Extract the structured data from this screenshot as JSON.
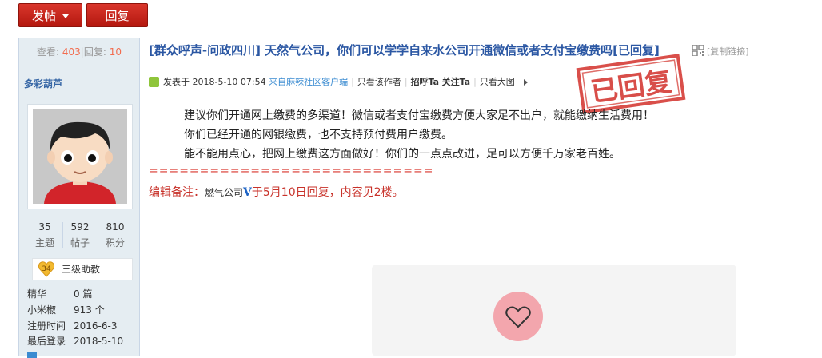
{
  "toolbar": {
    "post_label": "发帖",
    "reply_label": "回复"
  },
  "stats": {
    "views_label": "查看:",
    "views": "403",
    "replies_label": "回复:",
    "replies": "10"
  },
  "author": {
    "name": "多彩葫芦",
    "counts": [
      {
        "value": "35",
        "label": "主题"
      },
      {
        "value": "592",
        "label": "帖子"
      },
      {
        "value": "810",
        "label": "积分"
      }
    ],
    "rank_level": "34",
    "rank_name": "三级助教",
    "info": [
      {
        "key": "精华",
        "value": "0 篇"
      },
      {
        "key": "小米椒",
        "value": "913 个"
      },
      {
        "key": "注册时间",
        "value": "2016-6-3"
      },
      {
        "key": "最后登录",
        "value": "2018-5-10"
      }
    ]
  },
  "thread": {
    "title": "[群众呼声-问政四川] 天然气公司，你们可以学学自来水公司开通微信或者支付宝缴费吗[已回复]",
    "copy_link": "[复制链接]"
  },
  "meta": {
    "posted_prefix": "发表于 2018-5-10 07:54",
    "source": "来自麻辣社区客户端",
    "only_author": "只看该作者",
    "greet": "招呼Ta",
    "follow": "关注Ta",
    "only_large": "只看大图"
  },
  "stamp": {
    "text": "已回复"
  },
  "post": {
    "lines": [
      "建议你们开通网上缴费的多渠道！微信或者支付宝缴费方便大家足不出户，就能缴纳生活费用！",
      "你们已经开通的网银缴费，也不支持预付费用户缴费。",
      "能不能用点心，把网上缴费这方面做好！你们的一点点改进，足可以方便千万家老百姓。"
    ],
    "separator": "============================",
    "edit_prefix": "编辑备注：",
    "edit_user": "燃气公司",
    "edit_badge": "V",
    "edit_suffix": "于5月10日回复，内容见2楼。"
  },
  "colors": {
    "accent_red": "#c8322a",
    "title_blue": "#2b57a3",
    "sidebar_bg": "#e5edf2"
  }
}
